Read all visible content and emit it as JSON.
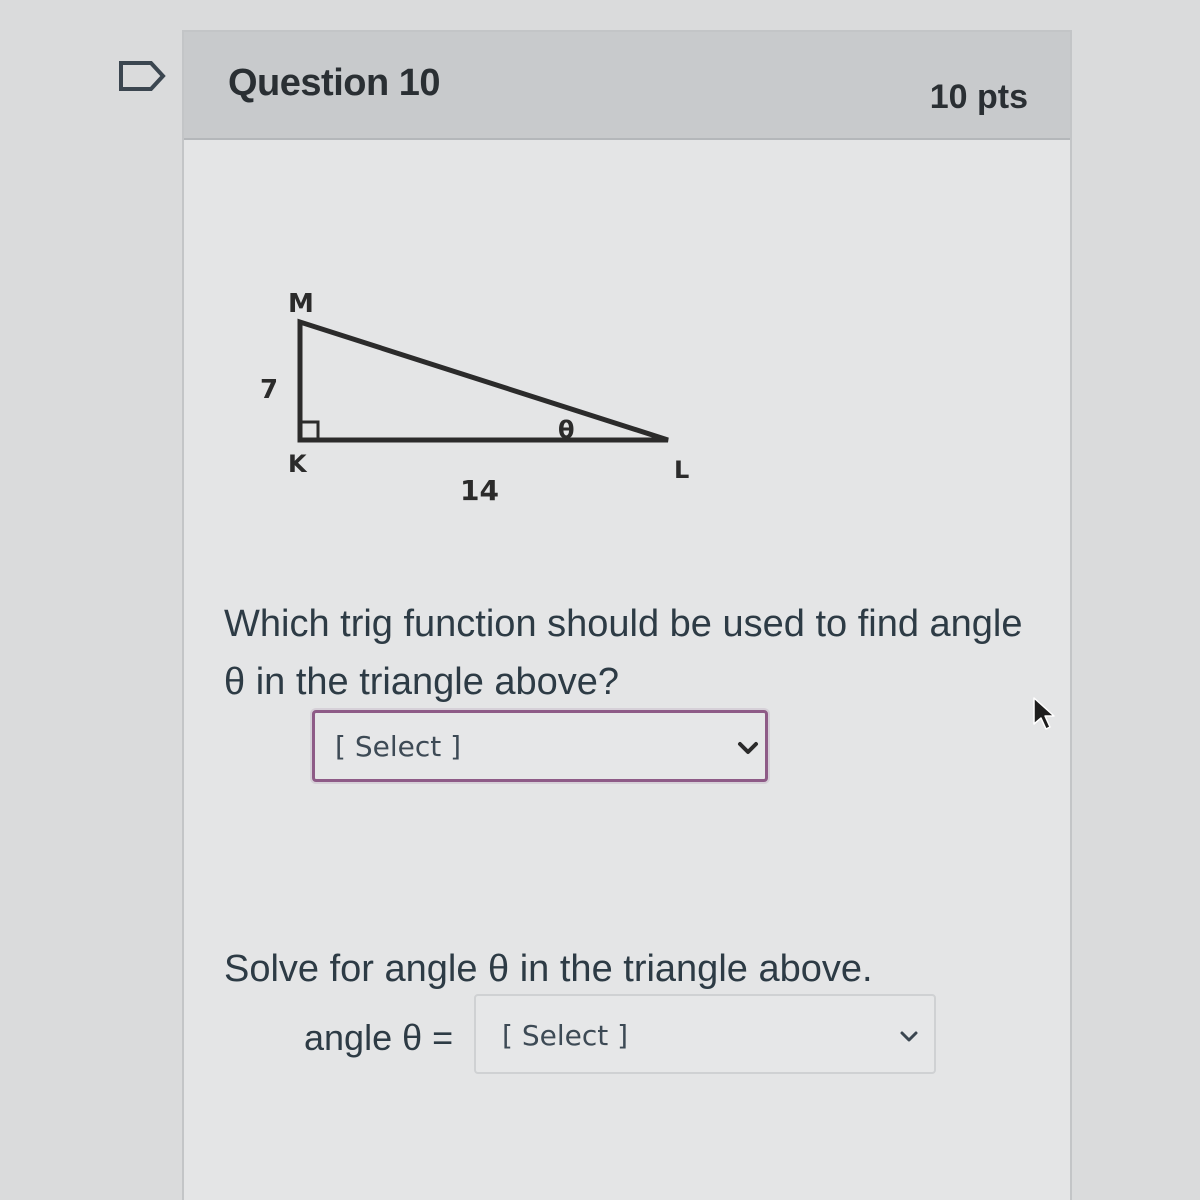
{
  "question": {
    "title": "Question 10",
    "points": "10 pts"
  },
  "figure": {
    "vertex_m": "M",
    "vertex_k": "K",
    "vertex_l": "L",
    "side_mk": "7",
    "side_kl": "14",
    "angle": "θ"
  },
  "part1": {
    "prompt": "Which trig function should be used to find angle θ in the triangle above?",
    "select_value": "[ Select ]"
  },
  "part2": {
    "prompt": "Solve for angle θ in the triangle above.",
    "label": "angle θ =",
    "select_value": "[ Select ]"
  },
  "icons": {
    "flag": "flag-icon",
    "chevron": "chevron-down-icon",
    "cursor": "mouse-cursor-icon"
  },
  "colors": {
    "focus_border": "#8e5b87",
    "header_bg": "#c8cacc",
    "card_bg": "#e4e5e6"
  }
}
